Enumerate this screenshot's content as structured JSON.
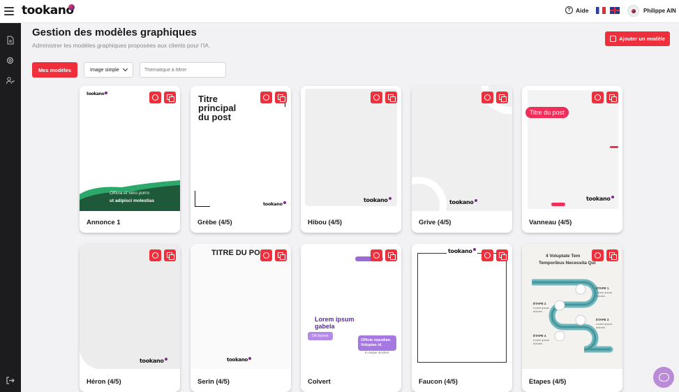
{
  "app": {
    "brand": "tookano"
  },
  "header": {
    "help_label": "Aide",
    "user_name": "Philippe AIN"
  },
  "page": {
    "title": "Gestion des modèles graphiques",
    "subtitle": "Administrer les modèles graphiques proposées aux clients pour l'IA.",
    "add_button": "Ajouter un modèle"
  },
  "filters": {
    "mine_button": "Mes modèles",
    "type_select": "Image simple",
    "theme_placeholder": "Thématique à filtrer"
  },
  "cards": [
    {
      "name": "Annonce 1",
      "text1": "Officia et vero porro",
      "text2": "ut adipisci molestias"
    },
    {
      "name": "Grèbe (4/5)",
      "title": "Titre principal du post"
    },
    {
      "name": "Hibou (4/5)"
    },
    {
      "name": "Grive (4/5)"
    },
    {
      "name": "Vanneau (4/5)",
      "title": "Titre du post"
    },
    {
      "name": "Héron (4/5)"
    },
    {
      "name": "Serin (4/5)",
      "title": "TITRE DU PO"
    },
    {
      "name": "Colvert",
      "title": "Lorem ipsum gabela",
      "tag": "Dit facere",
      "bubble": "Officia repudian. Voluptas id.",
      "note": "In neque incidunt"
    },
    {
      "name": "Faucon (4/5)"
    },
    {
      "name": "Etapes (4/5)",
      "title": "4 Voluptate Tem",
      "title2": "Temporibus Necessita Qui",
      "steps": [
        {
          "label": "ÉTAPE 1",
          "text": "Lorem ipsum dolores"
        },
        {
          "label": "ÉTAPE 2",
          "text": "Lorem ipsum dolores"
        },
        {
          "label": "ÉTAPE 3",
          "text": "Lorem ipsum dolores"
        },
        {
          "label": "ÉTAPE 4",
          "text": "Lorem ipsum dolores"
        }
      ]
    }
  ]
}
